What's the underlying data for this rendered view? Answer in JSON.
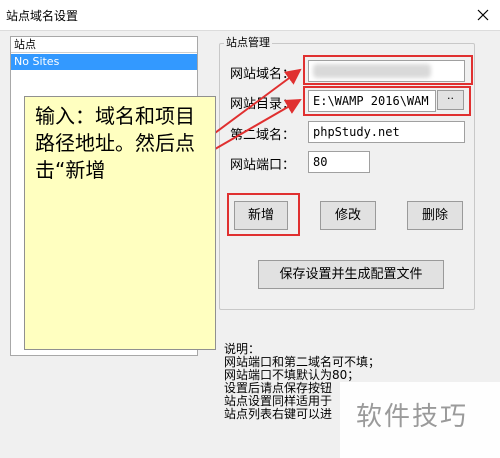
{
  "window": {
    "title": "站点域名设置"
  },
  "sites_list": {
    "header": "站点",
    "items": [
      "No Sites"
    ]
  },
  "group_title": "站点管理",
  "form": {
    "domain_label": "网站域名：",
    "domain_value": "",
    "dir_label": "网站目录：",
    "dir_value": "E:\\WAMP 2016\\WAM",
    "browse_label": "··",
    "second_label": "第二域名：",
    "second_value": "phpStudy.net",
    "port_label": "网站端口：",
    "port_value": "80"
  },
  "buttons": {
    "add": "新增",
    "edit": "修改",
    "delete": "删除",
    "save": "保存设置并生成配置文件"
  },
  "note": "输入：域名和项目路径地址。然后点击“新增",
  "description": {
    "lines": [
      "说明：",
      "网站端口和第二域名可不填；",
      "网站端口不填默认为80；",
      "设置后请点保存按钮",
      "站点设置同样适用于",
      "站点列表右键可以进"
    ]
  },
  "watermark": "软件技巧",
  "colors": {
    "highlight_red": "#e03030",
    "note_bg": "#ffffc0",
    "selection": "#3399ff"
  }
}
